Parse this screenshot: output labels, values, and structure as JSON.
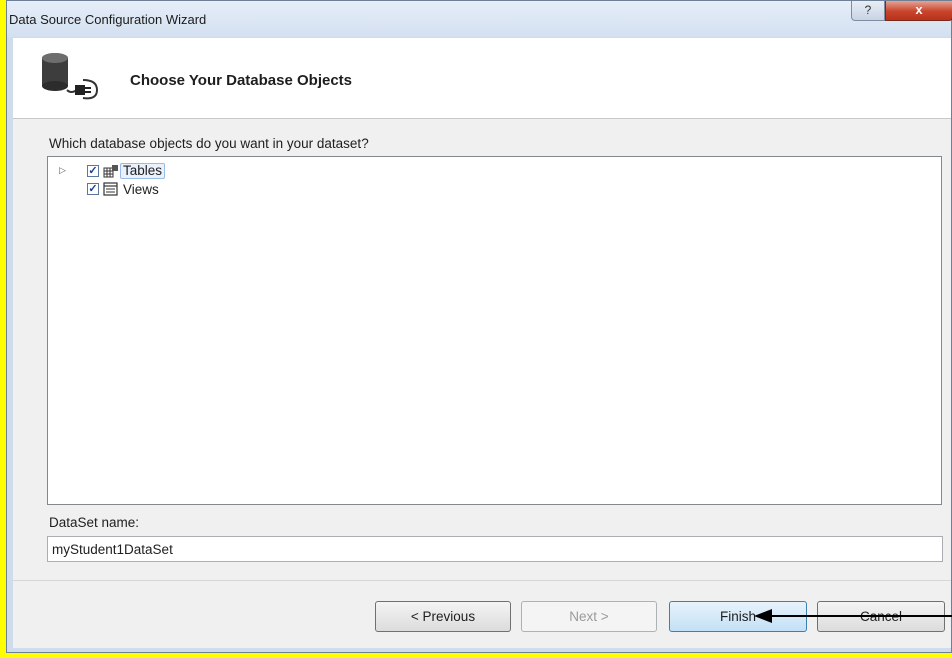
{
  "window": {
    "title": "Data Source Configuration Wizard",
    "help_label": "?",
    "close_label": "x"
  },
  "header": {
    "title": "Choose Your Database Objects",
    "icon": "database-connect-icon"
  },
  "prompt": "Which database objects do you want in your dataset?",
  "tree": {
    "items": [
      {
        "label": "Tables",
        "checked": true,
        "expandable": true,
        "icon": "table-icon",
        "selected": true
      },
      {
        "label": "Views",
        "checked": true,
        "expandable": false,
        "icon": "view-icon",
        "selected": false
      }
    ]
  },
  "dataset": {
    "label": "DataSet name:",
    "value": "myStudent1DataSet"
  },
  "buttons": {
    "previous": "< Previous",
    "next": "Next >",
    "finish": "Finish",
    "cancel": "Cancel"
  },
  "colors": {
    "highlight_frame": "#ffff00",
    "close_button": "#c8442b",
    "selection": "#e9f1fc"
  }
}
